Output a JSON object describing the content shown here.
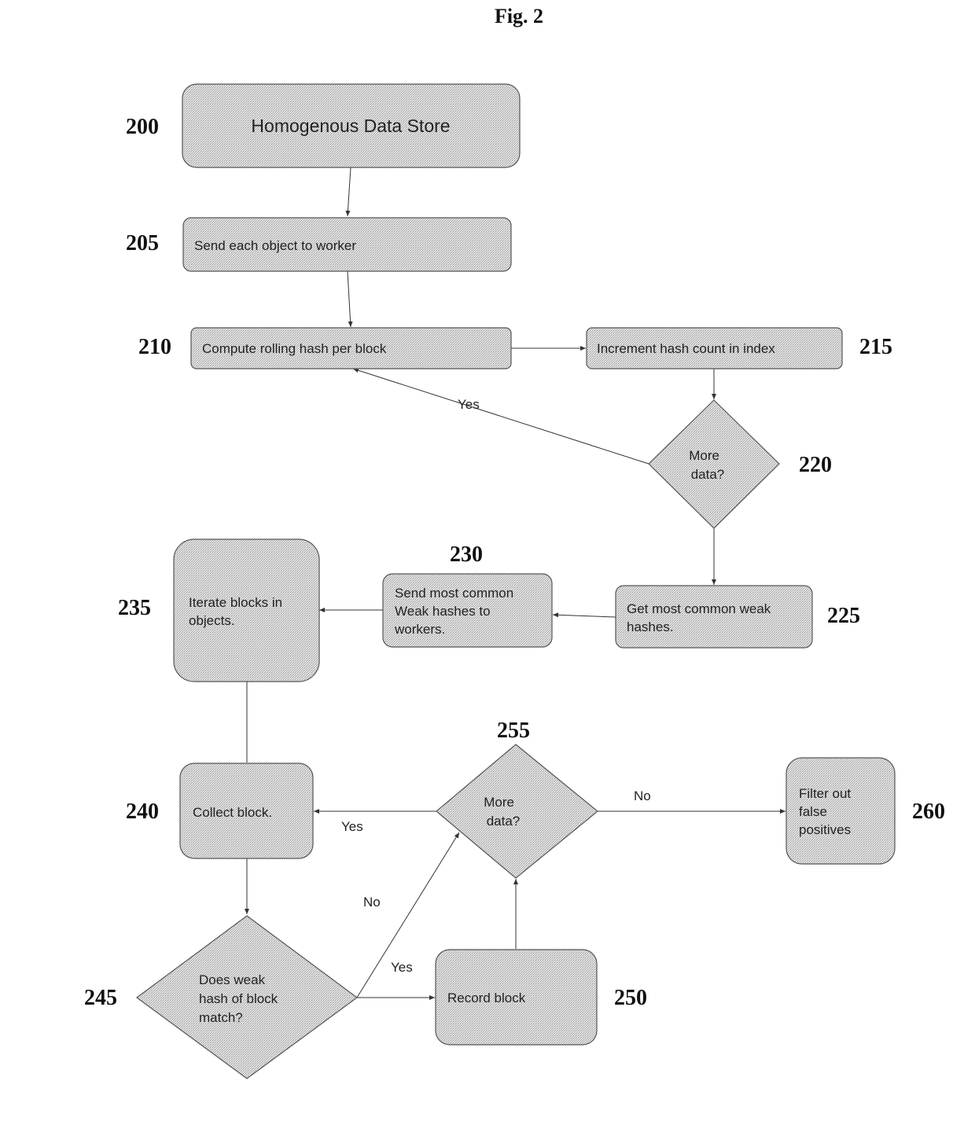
{
  "figure": {
    "title": "Fig. 2"
  },
  "nodes": {
    "n200": {
      "ref": "200",
      "lines": [
        "Homogenous Data Store"
      ]
    },
    "n205": {
      "ref": "205",
      "lines": [
        "Send each object to worker"
      ]
    },
    "n210": {
      "ref": "210",
      "lines": [
        "Compute rolling hash per block"
      ]
    },
    "n215": {
      "ref": "215",
      "lines": [
        "Increment hash count in index"
      ]
    },
    "n220": {
      "ref": "220",
      "lines": [
        "More",
        "data?"
      ]
    },
    "n225": {
      "ref": "225",
      "lines": [
        "Get most common weak",
        "hashes."
      ]
    },
    "n230": {
      "ref": "230",
      "lines": [
        "Send most common",
        "Weak hashes to",
        "workers."
      ]
    },
    "n235": {
      "ref": "235",
      "lines": [
        "Iterate blocks in",
        "objects."
      ]
    },
    "n240": {
      "ref": "240",
      "lines": [
        "Collect block."
      ]
    },
    "n245": {
      "ref": "245",
      "lines": [
        "Does weak",
        "hash of block",
        "match?"
      ]
    },
    "n250": {
      "ref": "250",
      "lines": [
        "Record block"
      ]
    },
    "n255": {
      "ref": "255",
      "lines": [
        "More",
        "data?"
      ]
    },
    "n260": {
      "ref": "260",
      "lines": [
        "Filter out",
        "false",
        "positives"
      ]
    }
  },
  "edge_labels": {
    "e220_210": "Yes",
    "e255_240": "Yes",
    "e255_260": "No",
    "e245_255": "No",
    "e245_250": "Yes"
  }
}
